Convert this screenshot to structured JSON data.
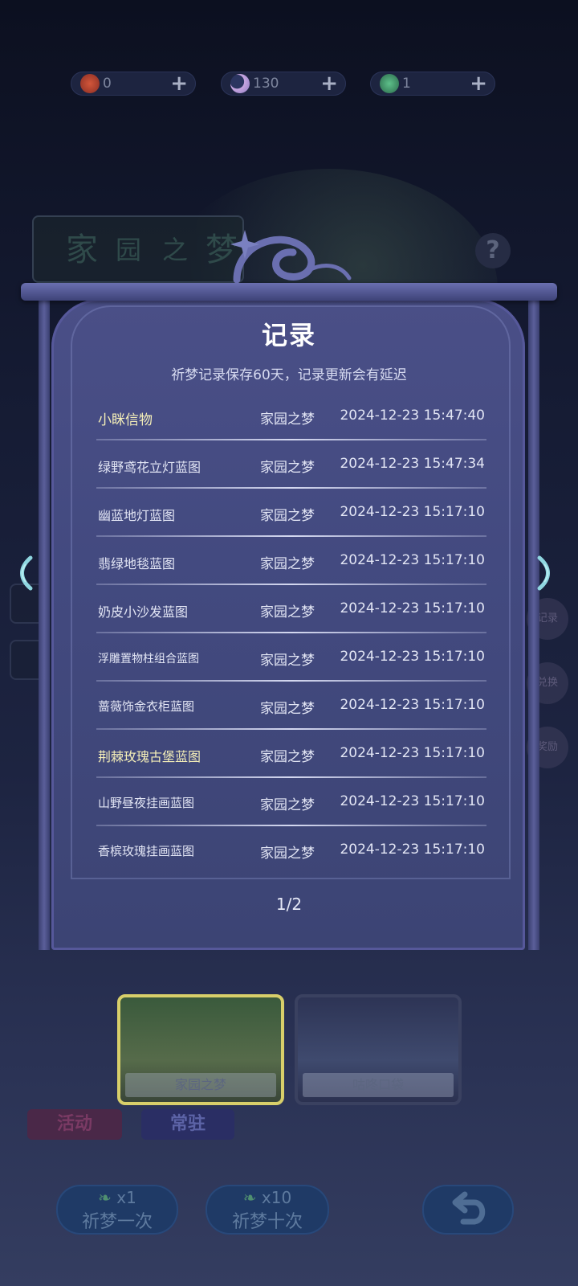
{
  "currency": [
    {
      "icon": "red-flower-icon",
      "value": "0"
    },
    {
      "icon": "moon-icon",
      "value": "130"
    },
    {
      "icon": "green-feather-icon",
      "value": "1"
    }
  ],
  "background": {
    "title": [
      "家",
      "园",
      "之",
      "梦"
    ],
    "side_buttons": [
      "记录",
      "兑换",
      "奖励"
    ]
  },
  "panel": {
    "title": "记录",
    "note": "祈梦记录保存60天，记录更新会有延迟",
    "rows": [
      {
        "name": "小眯信物",
        "pool": "家园之梦",
        "time": "2024-12-23 15:47:40",
        "highlight": true
      },
      {
        "name": "绿野鸢花立灯蓝图",
        "pool": "家园之梦",
        "time": "2024-12-23 15:47:34",
        "highlight": false
      },
      {
        "name": "幽蓝地灯蓝图",
        "pool": "家园之梦",
        "time": "2024-12-23 15:17:10",
        "highlight": false
      },
      {
        "name": "翡绿地毯蓝图",
        "pool": "家园之梦",
        "time": "2024-12-23 15:17:10",
        "highlight": false
      },
      {
        "name": "奶皮小沙发蓝图",
        "pool": "家园之梦",
        "time": "2024-12-23 15:17:10",
        "highlight": false
      },
      {
        "name": "浮雕置物柱组合蓝图",
        "pool": "家园之梦",
        "time": "2024-12-23 15:17:10",
        "highlight": false
      },
      {
        "name": "蔷薇饰金衣柜蓝图",
        "pool": "家园之梦",
        "time": "2024-12-23 15:17:10",
        "highlight": false
      },
      {
        "name": "荆棘玫瑰古堡蓝图",
        "pool": "家园之梦",
        "time": "2024-12-23 15:17:10",
        "highlight": true
      },
      {
        "name": "山野昼夜挂画蓝图",
        "pool": "家园之梦",
        "time": "2024-12-23 15:17:10",
        "highlight": false
      },
      {
        "name": "香槟玫瑰挂画蓝图",
        "pool": "家园之梦",
        "time": "2024-12-23 15:17:10",
        "highlight": false
      }
    ],
    "page": "1/2"
  },
  "pools": [
    {
      "label": "家园之梦",
      "selected": true
    },
    {
      "label": "咕咚口袋",
      "selected": false
    }
  ],
  "tabs": {
    "event": "活动",
    "permanent": "常驻"
  },
  "actions": {
    "pull_once": {
      "count": "x1",
      "label": "祈梦一次"
    },
    "pull_ten": {
      "count": "x10",
      "label": "祈梦十次"
    }
  },
  "colors": {
    "panel": "#454b84",
    "highlight_text": "#f5efb8",
    "accent_button": "#1f3a66",
    "selected_card_border": "#d8cf6a"
  }
}
